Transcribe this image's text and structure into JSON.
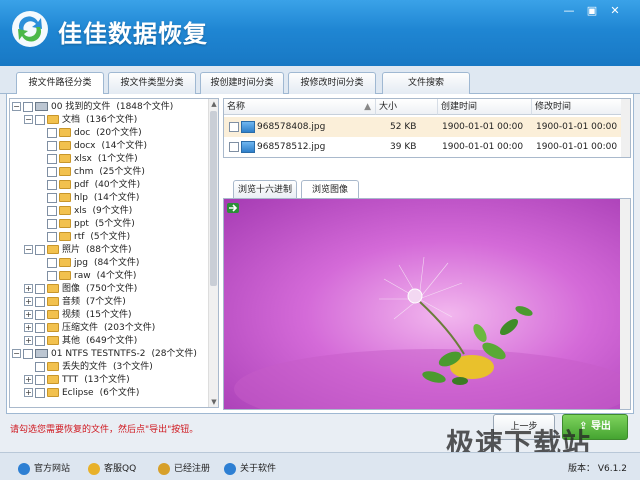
{
  "app": {
    "title": "佳佳数据恢复"
  },
  "window": {
    "min_icon": "minimize-icon",
    "max_icon": "maximize-icon",
    "close_icon": "close-icon"
  },
  "tabs": [
    {
      "label": "按文件路径分类",
      "active": true
    },
    {
      "label": "按文件类型分类",
      "active": false
    },
    {
      "label": "按创建时间分类",
      "active": false
    },
    {
      "label": "按修改时间分类",
      "active": false
    },
    {
      "label": "文件搜索",
      "active": false
    }
  ],
  "tree": [
    {
      "exp": "⊟",
      "icon": "drive",
      "name": "00  找到的文件",
      "count": "(1848个文件)"
    },
    {
      "exp": "⊟",
      "icon": "folder",
      "name": "文档",
      "count": "(136个文件)"
    },
    {
      "exp": "",
      "icon": "folder",
      "name": "doc",
      "count": "(20个文件)"
    },
    {
      "exp": "",
      "icon": "folder",
      "name": "docx",
      "count": "(14个文件)"
    },
    {
      "exp": "",
      "icon": "folder",
      "name": "xlsx",
      "count": "(1个文件)"
    },
    {
      "exp": "",
      "icon": "folder",
      "name": "chm",
      "count": "(25个文件)"
    },
    {
      "exp": "",
      "icon": "folder",
      "name": "pdf",
      "count": "(40个文件)"
    },
    {
      "exp": "",
      "icon": "folder",
      "name": "hlp",
      "count": "(14个文件)"
    },
    {
      "exp": "",
      "icon": "folder",
      "name": "xls",
      "count": "(9个文件)"
    },
    {
      "exp": "",
      "icon": "folder",
      "name": "ppt",
      "count": "(5个文件)"
    },
    {
      "exp": "",
      "icon": "folder",
      "name": "rtf",
      "count": "(5个文件)"
    },
    {
      "exp": "⊟",
      "icon": "folder",
      "name": "照片",
      "count": "(88个文件)"
    },
    {
      "exp": "",
      "icon": "folder",
      "name": "jpg",
      "count": "(84个文件)"
    },
    {
      "exp": "",
      "icon": "folder",
      "name": "raw",
      "count": "(4个文件)"
    },
    {
      "exp": "⊞",
      "icon": "folder",
      "name": "图像",
      "count": "(750个文件)"
    },
    {
      "exp": "⊞",
      "icon": "folder",
      "name": "音频",
      "count": "(7个文件)"
    },
    {
      "exp": "⊞",
      "icon": "folder",
      "name": "视频",
      "count": "(15个文件)"
    },
    {
      "exp": "⊞",
      "icon": "folder",
      "name": "压缩文件",
      "count": "(203个文件)"
    },
    {
      "exp": "⊞",
      "icon": "folder",
      "name": "其他",
      "count": "(649个文件)"
    },
    {
      "exp": "⊟",
      "icon": "drive",
      "name": "01  NTFS  TESTNTFS-2",
      "count": "(28个文件)"
    },
    {
      "exp": "",
      "icon": "folder",
      "name": "丢失的文件",
      "count": "(3个文件)"
    },
    {
      "exp": "⊞",
      "icon": "folder",
      "name": "TTT",
      "count": "(13个文件)"
    },
    {
      "exp": "⊞",
      "icon": "folder",
      "name": "Eclipse",
      "count": "(6个文件)"
    }
  ],
  "filelist": {
    "columns": [
      "名称",
      "大小",
      "创建时间",
      "修改时间"
    ],
    "rows": [
      {
        "name": "968578408.jpg",
        "size": "52 KB",
        "created": "1900-01-01  00:00",
        "modified": "1900-01-01  00:00",
        "selected": true
      },
      {
        "name": "968578512.jpg",
        "size": "39 KB",
        "created": "1900-01-01  00:00",
        "modified": "1900-01-01  00:00",
        "selected": false
      }
    ]
  },
  "preview_tabs": [
    {
      "label": "浏览十六进制",
      "active": false
    },
    {
      "label": "浏览图像",
      "active": true
    }
  ],
  "hint": "请勾选您需要恢复的文件，然后点\"导出\"按钮。",
  "buttons": {
    "prev": "上一步",
    "export": "导出"
  },
  "status": [
    {
      "label": "官方网站",
      "icon": "home-icon",
      "color": "#2d7fd3"
    },
    {
      "label": "客服QQ",
      "icon": "qq-icon",
      "color": "#e8b12a"
    },
    {
      "label": "已经注册",
      "icon": "key-icon",
      "color": "#d7a02a"
    },
    {
      "label": "关于软件",
      "icon": "info-icon",
      "color": "#2d7fd3"
    }
  ],
  "version": "版本：  V6.1.2",
  "watermark": "极速下载站",
  "colors": {
    "title_bar": "#1f86d3",
    "hint_text": "#d0181f",
    "export_button": "#45a431",
    "selected_row": "#fbefd9"
  }
}
